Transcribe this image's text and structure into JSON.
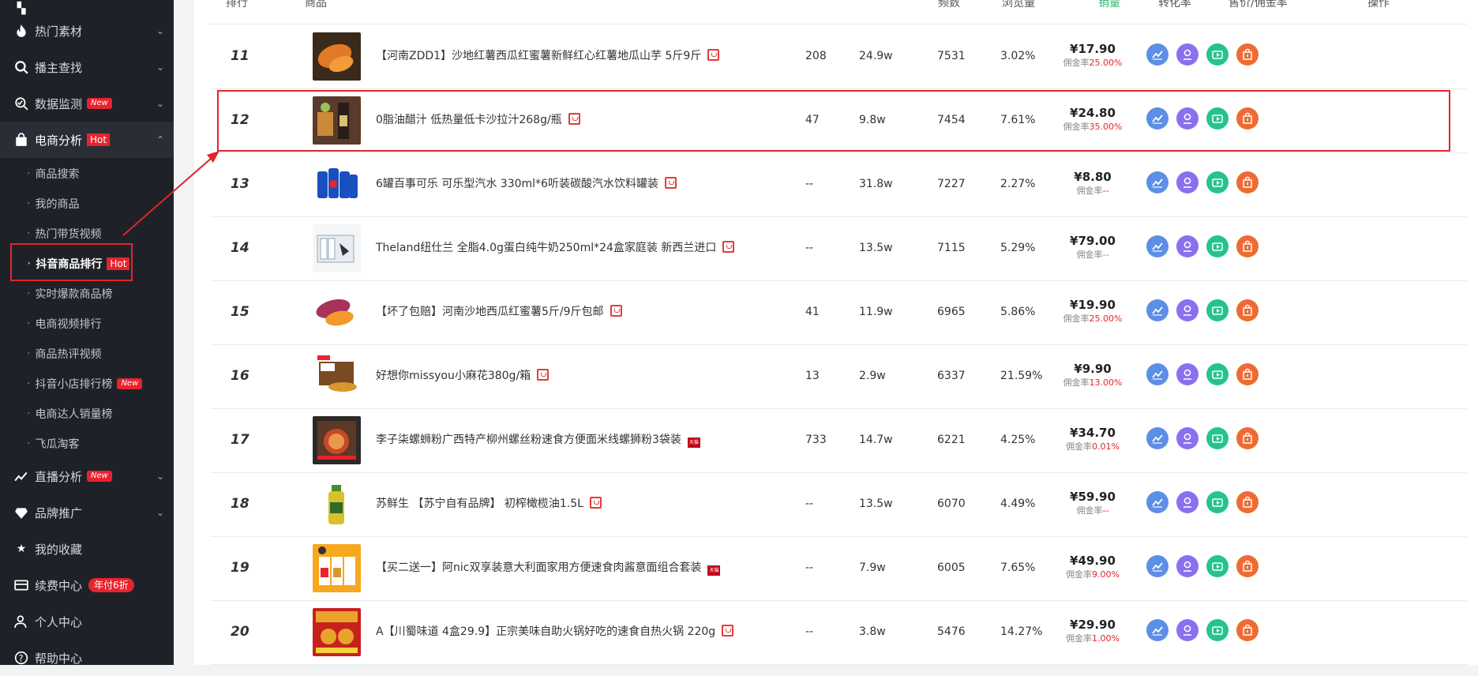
{
  "sidebar": {
    "items": [
      {
        "label": "热门素材",
        "icon": "flame-icon",
        "chevron": true
      },
      {
        "label": "播主查找",
        "icon": "search-icon",
        "chevron": true
      },
      {
        "label": "数据监测",
        "icon": "monitor-icon",
        "badge": "New",
        "chevron": true
      },
      {
        "label": "电商分析",
        "icon": "shopping-bag-icon",
        "badge": "Hot",
        "chevron": true,
        "expanded": true
      }
    ],
    "subitems": [
      {
        "label": "商品搜索"
      },
      {
        "label": "我的商品"
      },
      {
        "label": "热门带货视频"
      },
      {
        "label": "抖音商品排行",
        "badge": "Hot",
        "current": true
      },
      {
        "label": "实时爆款商品榜"
      },
      {
        "label": "电商视频排行"
      },
      {
        "label": "商品热评视频"
      },
      {
        "label": "抖音小店排行榜",
        "badge": "New"
      },
      {
        "label": "电商达人销量榜"
      },
      {
        "label": "飞瓜淘客"
      }
    ],
    "bottom_items": [
      {
        "label": "直播分析",
        "icon": "live-chart-icon",
        "badge": "New",
        "chevron": true
      },
      {
        "label": "品牌推广",
        "icon": "diamond-icon",
        "chevron": true
      },
      {
        "label": "我的收藏",
        "icon": "star-icon"
      },
      {
        "label": "续费中心",
        "icon": "card-icon",
        "promo": "年付6折"
      },
      {
        "label": "个人中心",
        "icon": "user-icon"
      },
      {
        "label": "帮助中心",
        "icon": "help-icon"
      }
    ]
  },
  "table": {
    "headers": {
      "rank": "排行",
      "product": "商品",
      "freq": "频数",
      "views": "浏览量",
      "sales": "销量",
      "conv": "转化率",
      "price": "售价/佣金率",
      "ops": "操作"
    },
    "commission_label": "佣金率",
    "rows": [
      {
        "rank": "11",
        "title": "【河南ZDD1】沙地红薯西瓜红蜜薯新鲜红心红薯地瓜山芋 5斤9斤",
        "shop": "store",
        "freq": "208",
        "views": "24.9w",
        "sales": "7531",
        "conv": "3.02%",
        "price": "¥17.90",
        "commission": "25.00%",
        "thumb": "sweet-potato"
      },
      {
        "rank": "12",
        "title": "0脂油醋汁 低热量低卡沙拉汁268g/瓶",
        "shop": "store",
        "freq": "47",
        "views": "9.8w",
        "sales": "7454",
        "conv": "7.61%",
        "price": "¥24.80",
        "commission": "35.00%",
        "thumb": "dressing"
      },
      {
        "rank": "13",
        "title": "6罐百事可乐 可乐型汽水 330ml*6听装碳酸汽水饮料罐装",
        "shop": "store",
        "freq": "--",
        "views": "31.8w",
        "sales": "7227",
        "conv": "2.27%",
        "price": "¥8.80",
        "commission": "--",
        "thumb": "cola"
      },
      {
        "rank": "14",
        "title": "Theland纽仕兰 全脂4.0g蛋白纯牛奶250ml*24盒家庭装 新西兰进口",
        "shop": "store",
        "freq": "--",
        "views": "13.5w",
        "sales": "7115",
        "conv": "5.29%",
        "price": "¥79.00",
        "commission": "--",
        "commission_grey": true,
        "thumb": "milk"
      },
      {
        "rank": "15",
        "title": "【坏了包赔】河南沙地西瓜红蜜薯5斤/9斤包邮",
        "shop": "store",
        "freq": "41",
        "views": "11.9w",
        "sales": "6965",
        "conv": "5.86%",
        "price": "¥19.90",
        "commission": "25.00%",
        "thumb": "sweet-potato2"
      },
      {
        "rank": "16",
        "title": "好想你missyou小麻花380g/箱",
        "shop": "store",
        "freq": "13",
        "views": "2.9w",
        "sales": "6337",
        "conv": "21.59%",
        "price": "¥9.90",
        "commission": "13.00%",
        "thumb": "snack"
      },
      {
        "rank": "17",
        "title": "李子柒螺蛳粉广西特产柳州螺丝粉速食方便面米线螺狮粉3袋装",
        "shop": "tmall",
        "freq": "733",
        "views": "14.7w",
        "sales": "6221",
        "conv": "4.25%",
        "price": "¥34.70",
        "commission": "0.01%",
        "thumb": "noodle"
      },
      {
        "rank": "18",
        "title": "苏鲜生 【苏宁自有品牌】 初榨橄榄油1.5L",
        "shop": "store",
        "freq": "--",
        "views": "13.5w",
        "sales": "6070",
        "conv": "4.49%",
        "price": "¥59.90",
        "commission": "--",
        "thumb": "oil"
      },
      {
        "rank": "19",
        "title": "【买二送一】阿nic双享装意大利面家用方便速食肉酱意面组合套装",
        "shop": "tmall",
        "freq": "--",
        "views": "7.9w",
        "sales": "6005",
        "conv": "7.65%",
        "price": "¥49.90",
        "commission": "9.00%",
        "thumb": "pasta"
      },
      {
        "rank": "20",
        "title": "A【川蜀味道 4盒29.9】正宗美味自助火锅好吃的速食自热火锅 220g",
        "shop": "store",
        "freq": "--",
        "views": "3.8w",
        "sales": "5476",
        "conv": "14.27%",
        "price": "¥29.90",
        "commission": "1.00%",
        "thumb": "hotpot"
      }
    ]
  },
  "colors": {
    "accent_red": "#e8232e",
    "sales_header": "#3cb371",
    "sidebar_bg": "#1f2128"
  }
}
